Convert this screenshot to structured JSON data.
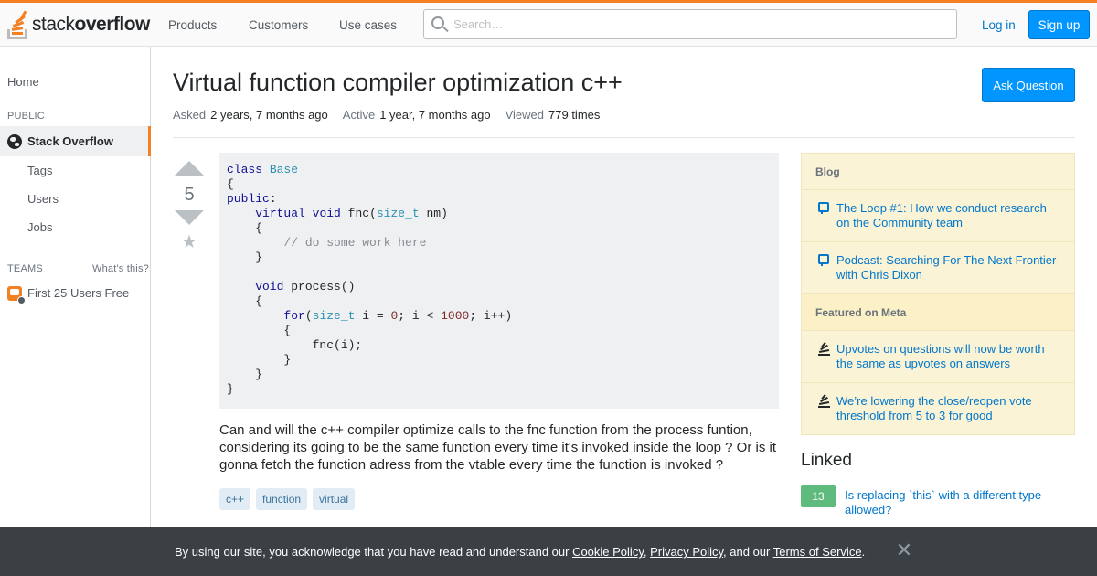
{
  "header": {
    "logo_light": "stack",
    "logo_bold": "overflow",
    "nav": [
      "Products",
      "Customers",
      "Use cases"
    ],
    "search_placeholder": "Search…",
    "login": "Log in",
    "signup": "Sign up"
  },
  "sidebar": {
    "home": "Home",
    "public_heading": "PUBLIC",
    "active_item": "Stack Overflow",
    "items": [
      "Tags",
      "Users",
      "Jobs"
    ],
    "teams_heading": "TEAMS",
    "whats_this": "What's this?",
    "teams_item": "First 25 Users Free"
  },
  "question": {
    "title": "Virtual function compiler optimization c++",
    "ask_button": "Ask Question",
    "asked_label": "Asked",
    "asked_value": "2 years, 7 months ago",
    "active_label": "Active",
    "active_value": "1 year, 7 months ago",
    "viewed_label": "Viewed",
    "viewed_value": "779 times",
    "votes": "5",
    "code_lines": [
      [
        [
          "kw",
          "class"
        ],
        [
          "p",
          " "
        ],
        [
          "ty",
          "Base"
        ]
      ],
      [
        [
          "p",
          "{"
        ]
      ],
      [
        [
          "kw",
          "public"
        ],
        [
          "p",
          ":"
        ]
      ],
      [
        [
          "p",
          "    "
        ],
        [
          "kw",
          "virtual"
        ],
        [
          "p",
          " "
        ],
        [
          "kw",
          "void"
        ],
        [
          "p",
          " fnc("
        ],
        [
          "ty",
          "size_t"
        ],
        [
          "p",
          " nm)"
        ]
      ],
      [
        [
          "p",
          "    {"
        ]
      ],
      [
        [
          "p",
          "        "
        ],
        [
          "cm",
          "// do some work here"
        ]
      ],
      [
        [
          "p",
          "    }"
        ]
      ],
      [
        [
          "p",
          ""
        ]
      ],
      [
        [
          "p",
          "    "
        ],
        [
          "kw",
          "void"
        ],
        [
          "p",
          " process()"
        ]
      ],
      [
        [
          "p",
          "    {"
        ]
      ],
      [
        [
          "p",
          "        "
        ],
        [
          "kw",
          "for"
        ],
        [
          "p",
          "("
        ],
        [
          "ty",
          "size_t"
        ],
        [
          "p",
          " i = "
        ],
        [
          "nu",
          "0"
        ],
        [
          "p",
          "; i < "
        ],
        [
          "nu",
          "1000"
        ],
        [
          "p",
          "; i++)"
        ]
      ],
      [
        [
          "p",
          "        {"
        ]
      ],
      [
        [
          "p",
          "            fnc(i);"
        ]
      ],
      [
        [
          "p",
          "        }"
        ]
      ],
      [
        [
          "p",
          "    }"
        ]
      ],
      [
        [
          "p",
          "}"
        ]
      ]
    ],
    "body": "Can and will the c++ compiler optimize calls to the fnc function from the process funtion, considering its going to be the same function every time it's invoked inside the loop ? Or is it gonna fetch the function adress from the vtable every time the function is invoked ?",
    "tags": [
      "c++",
      "function",
      "virtual"
    ]
  },
  "right": {
    "blog_heading": "Blog",
    "blog_items": [
      "The Loop #1: How we conduct research on the Community team",
      "Podcast: Searching For The Next Frontier with Chris Dixon"
    ],
    "meta_heading": "Featured on Meta",
    "meta_items": [
      "Upvotes on questions will now be worth the same as upvotes on answers",
      "We’re lowering the close/reopen vote threshold from 5 to 3 for good"
    ],
    "linked_heading": "Linked",
    "linked_score": "13",
    "linked_title": "Is replacing `this` with a different type allowed?"
  },
  "cookie": {
    "prefix": "By using our site, you acknowledge that you have read and understand our ",
    "cookie_policy": "Cookie Policy",
    "sep1": ", ",
    "privacy_policy": "Privacy Policy",
    "sep2": ", and our ",
    "terms": "Terms of Service",
    "suffix": ".",
    "close": "✕"
  },
  "colors": {
    "accent_orange": "#f48024",
    "primary_blue": "#0095ff",
    "link_blue": "#0077cc",
    "accepted_green": "#5eba7d"
  }
}
